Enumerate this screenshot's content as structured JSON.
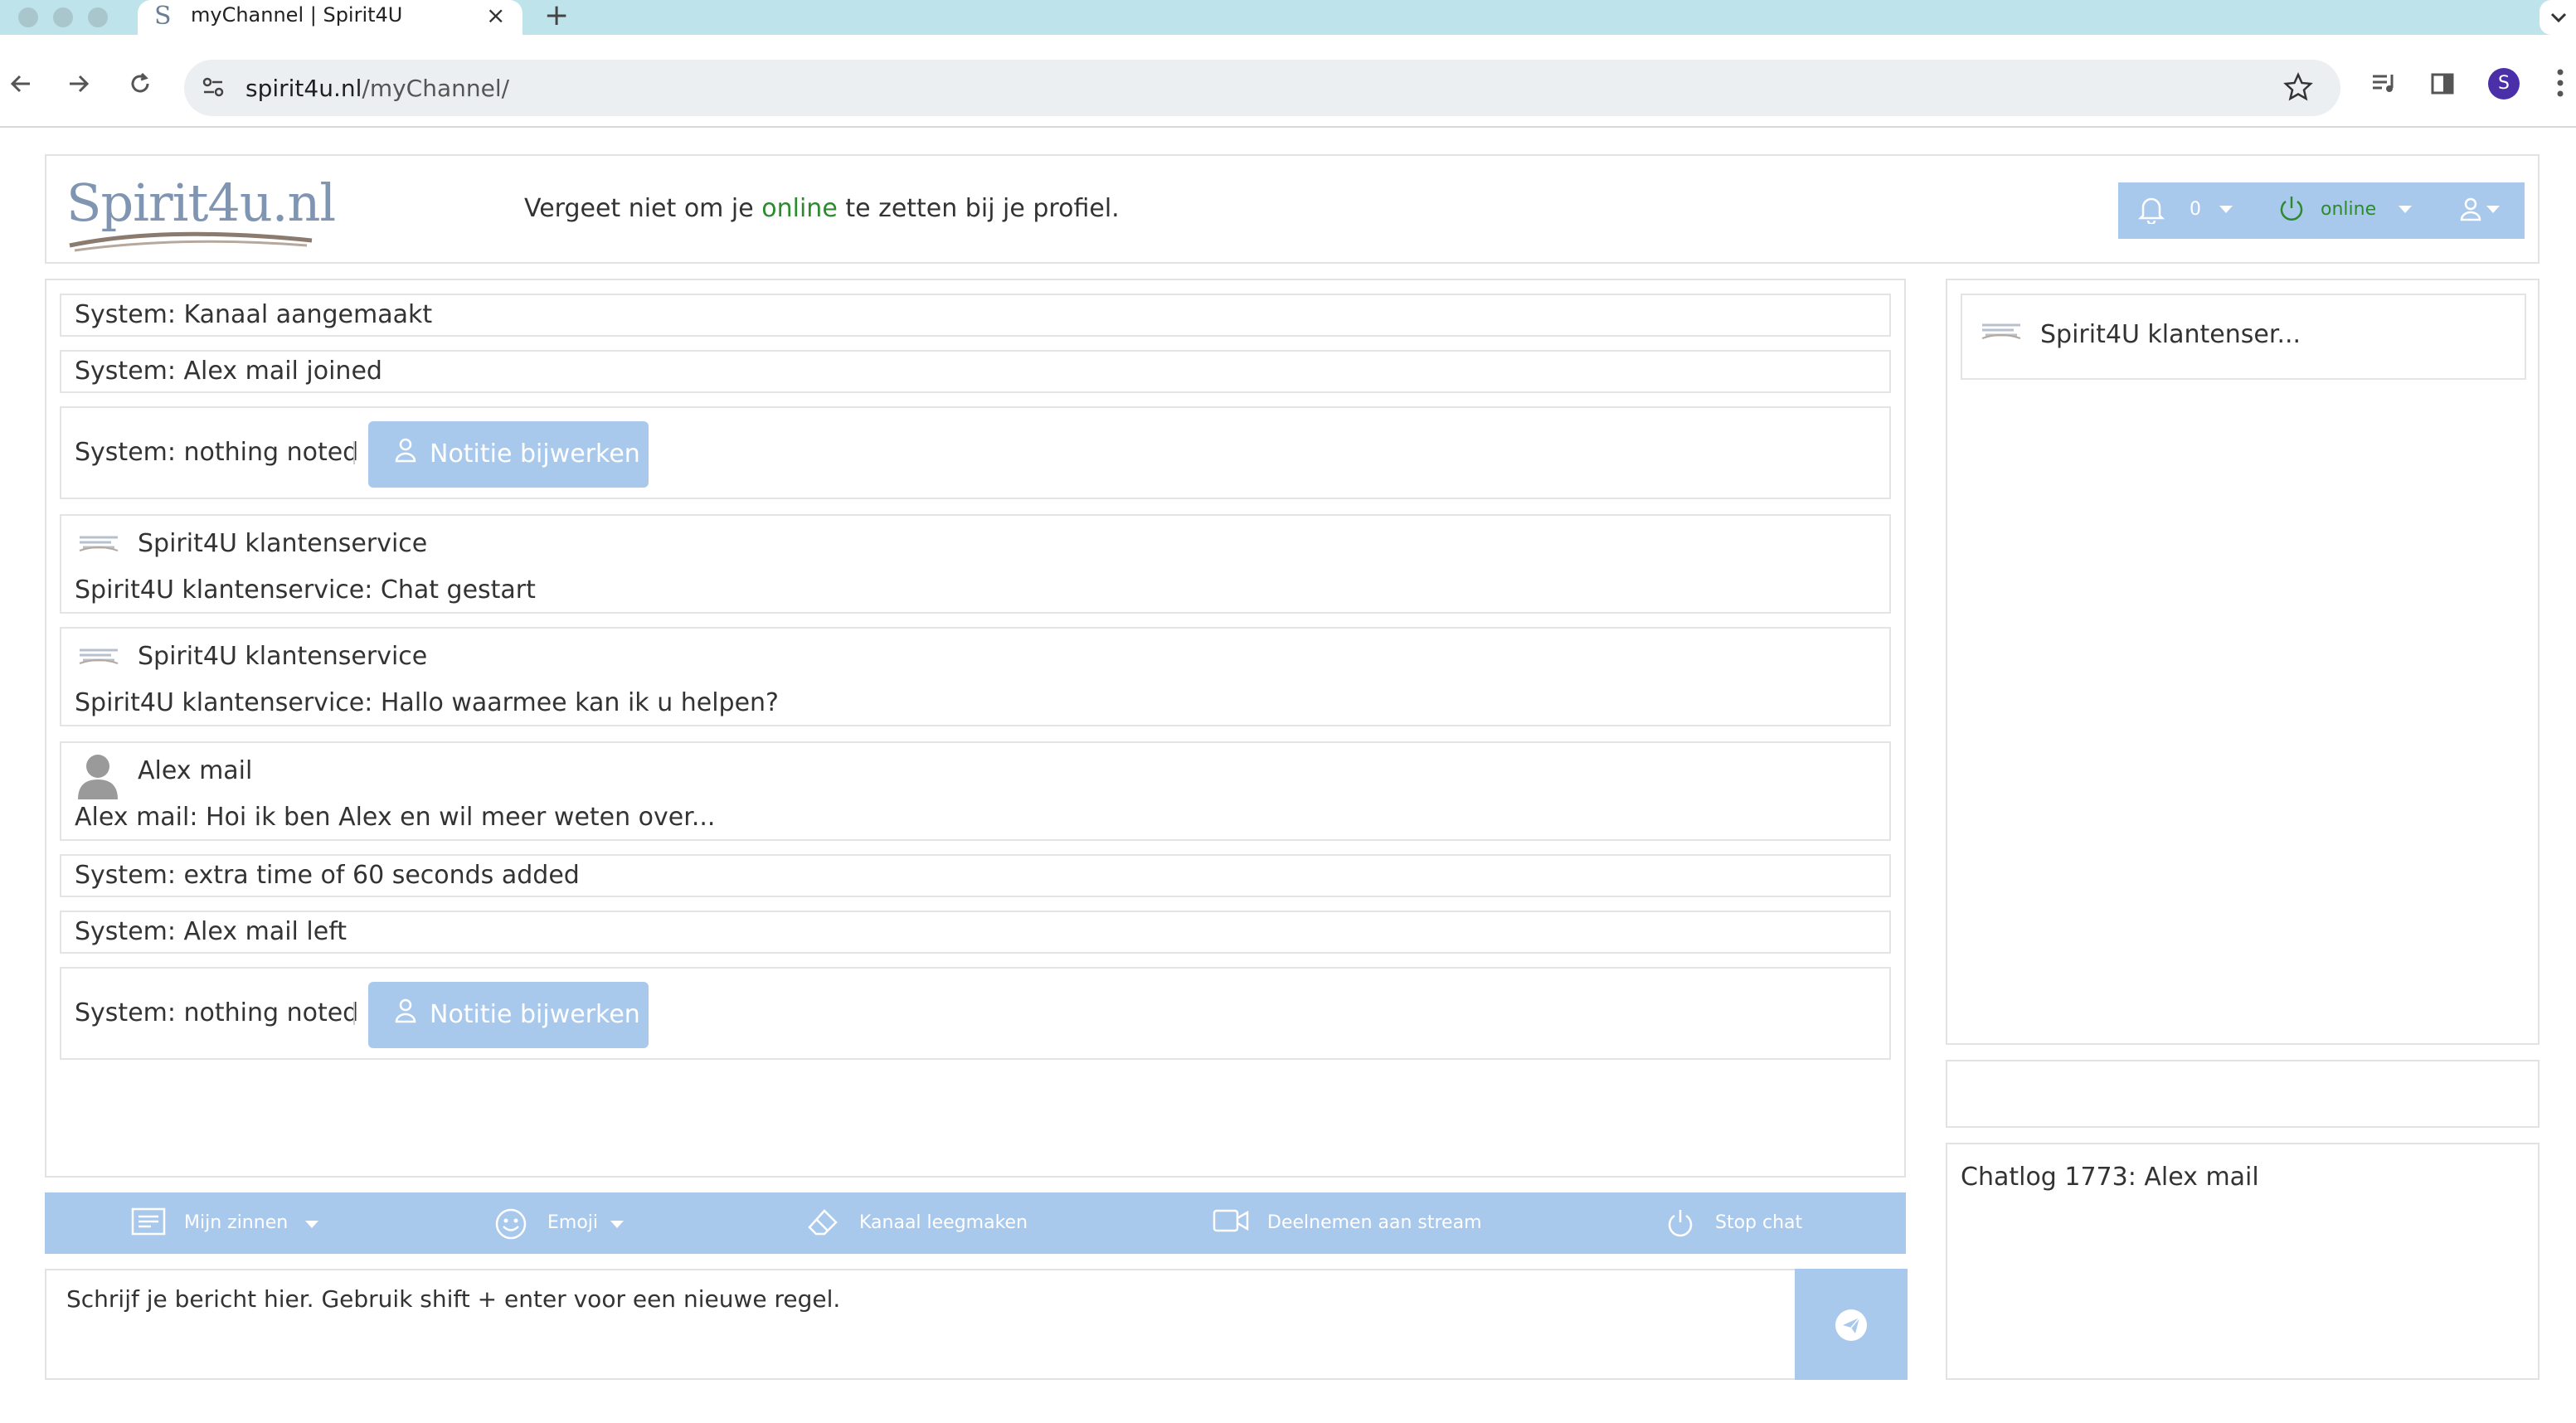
{
  "browser": {
    "tab_favicon": "S",
    "tab_title": "myChannel | Spirit4U",
    "tab_close": "×",
    "new_tab": "+",
    "url_host": "spirit4u.nl",
    "url_path": "/myChannel/",
    "profile_initial": "S"
  },
  "header": {
    "logo_text": "Spirit4u.nl",
    "message_before": "Vergeet niet om je ",
    "message_highlight": "online",
    "message_after": " te zetten bij je profiel.",
    "notification_count": "0",
    "status_label": "online",
    "colors": {
      "accent": "#a9c9ec",
      "online": "#2d8a2d"
    }
  },
  "chat": {
    "messages": [
      {
        "type": "system",
        "text": "System: Kanaal aangemaakt"
      },
      {
        "type": "system",
        "text": "System: Alex mail joined"
      },
      {
        "type": "note",
        "text": "System: nothing noted",
        "button": "Notitie bijwerken"
      },
      {
        "type": "user",
        "sender": "Spirit4U klantenservice",
        "text": "Spirit4U klantenservice: Chat gestart"
      },
      {
        "type": "user",
        "sender": "Spirit4U klantenservice",
        "text": "Spirit4U klantenservice: Hallo waarmee kan ik u helpen?"
      },
      {
        "type": "user",
        "sender": "Alex mail",
        "text": "Alex mail: Hoi ik ben Alex en wil meer weten over..."
      },
      {
        "type": "system",
        "text": "System: extra time of 60 seconds added"
      },
      {
        "type": "system",
        "text": "System: Alex mail left"
      },
      {
        "type": "note",
        "text": "System: nothing noted",
        "button": "Notitie bijwerken"
      }
    ]
  },
  "actions": {
    "phrases": "Mijn zinnen",
    "emoji": "Emoji",
    "clear": "Kanaal leegmaken",
    "join_stream": "Deelnemen aan stream",
    "stop_chat": "Stop chat"
  },
  "composer": {
    "placeholder": "Schrijf je bericht hier. Gebruik shift + enter voor een nieuwe regel."
  },
  "sidebar": {
    "contact_name": "Spirit4U klantenser...",
    "chatlog_title": "Chatlog 1773: Alex mail"
  }
}
